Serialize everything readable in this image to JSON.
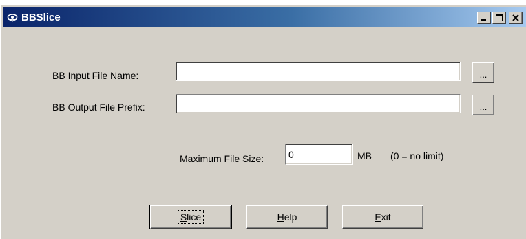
{
  "window": {
    "title": "BBSlice",
    "controls": {
      "minimize": "minimize-icon",
      "maximize": "maximize-icon",
      "close": "close-icon"
    }
  },
  "form": {
    "input_label": "BB Input File Name:",
    "input_value": "",
    "output_label": "BB Output File Prefix:",
    "output_value": "",
    "browse_label": "...",
    "max_size_label": "Maximum File Size:",
    "max_size_value": "0",
    "unit": "MB",
    "hint": "(0 = no limit)"
  },
  "buttons": {
    "slice": {
      "mnemonic": "S",
      "rest": "lice"
    },
    "help": {
      "mnemonic": "H",
      "rest": "elp"
    },
    "exit": {
      "mnemonic": "E",
      "rest": "xit"
    }
  },
  "colors": {
    "face": "#d4d0c8",
    "title_start": "#0a246a",
    "title_end": "#a6caf0"
  }
}
